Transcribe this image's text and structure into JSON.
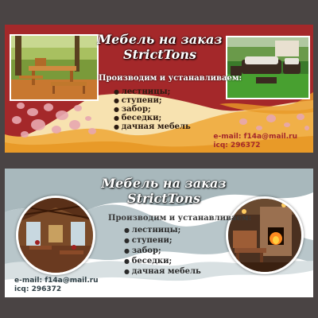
{
  "banner_red": {
    "title_line1": "Мебель на заказ",
    "title_line2": "StrictTons",
    "subtitle": "Производим и устанавливаем:",
    "items": [
      "лестницы;",
      "ступени;",
      "забор;",
      "беседки;",
      "дачная мебель"
    ],
    "email": "e-mail: f14a@mail.ru",
    "icq": "icq: 296372",
    "colors": {
      "background": "#a4282a",
      "wave": "#f0b048",
      "cream": "#f7e2b0"
    }
  },
  "banner_grey": {
    "title_line1": "Мебель на заказ",
    "title_line2": "StrictTons",
    "subtitle": "Производим и устанавливаем:",
    "items": [
      "лестницы;",
      "ступени;",
      "забор;",
      "беседки;",
      "дачная мебель"
    ],
    "email": "e-mail: f14a@mail.ru",
    "icq": "icq: 296372",
    "colors": {
      "background": "#ffffff",
      "wave": "#a0b0b5"
    }
  }
}
